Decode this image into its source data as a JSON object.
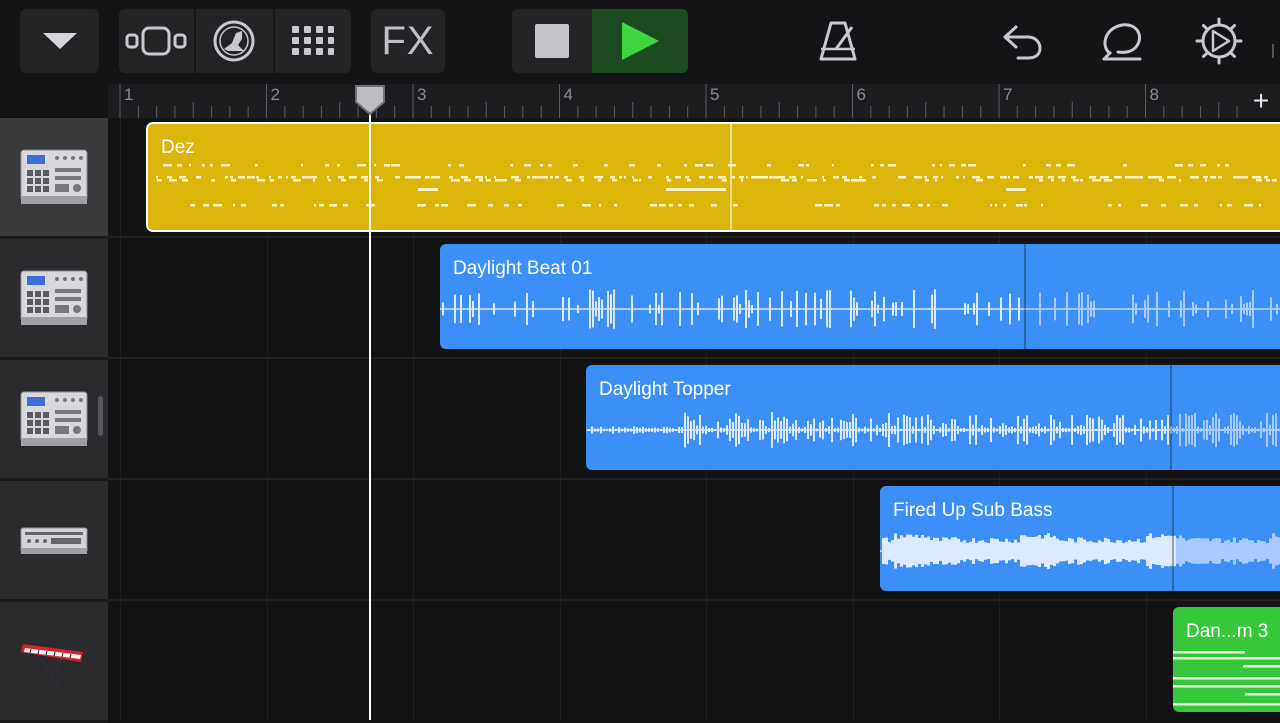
{
  "toolbar": {
    "browser_icon": "triangle-down-icon",
    "views": [
      "tracks-view-icon",
      "smart-controls-icon",
      "grid-view-icon"
    ],
    "fx_label": "FX",
    "transport": [
      "stop-icon",
      "play-icon"
    ],
    "right": [
      "metronome-icon",
      "undo-icon",
      "loop-icon",
      "settings-icon"
    ]
  },
  "ruler": {
    "bars": [
      "1",
      "2",
      "3",
      "4",
      "5",
      "6",
      "7",
      "8"
    ],
    "add_label": "+"
  },
  "tracks": [
    {
      "instrument_icon": "drum-machine-icon",
      "selected": true
    },
    {
      "instrument_icon": "drum-machine-icon",
      "selected": false
    },
    {
      "instrument_icon": "drum-machine-icon",
      "selected": false
    },
    {
      "instrument_icon": "synth-module-icon",
      "selected": false
    },
    {
      "instrument_icon": "red-keyboard-icon",
      "selected": false
    }
  ],
  "regions": [
    {
      "title": "Dez",
      "type": "midi",
      "color": "#dcb50b"
    },
    {
      "title": "Daylight Beat 01",
      "type": "audio",
      "color": "#3b8ff7"
    },
    {
      "title": "Daylight Topper",
      "type": "audio",
      "color": "#3b8ff7"
    },
    {
      "title": "Fired Up Sub Bass",
      "type": "audio",
      "color": "#3b8ff7"
    },
    {
      "title": "Dan...m 3",
      "type": "midi",
      "color": "#35c83b"
    }
  ],
  "colors": {
    "transport_play_bg": "#1c4a21",
    "play": "#3ed53e",
    "icon": "#bfbfc3"
  }
}
